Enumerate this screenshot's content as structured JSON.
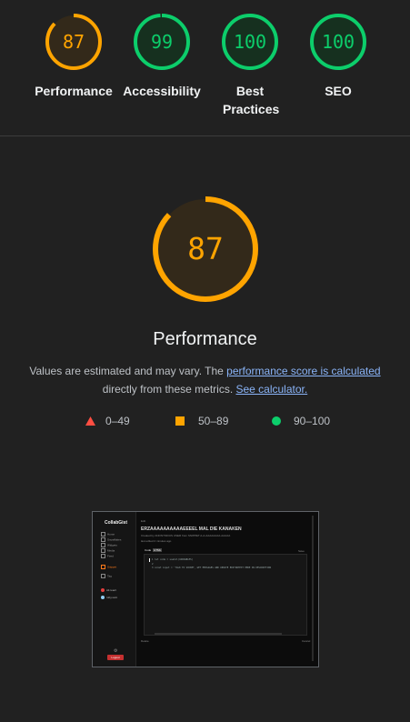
{
  "scores": [
    {
      "name": "Performance",
      "score": "87",
      "value": 87,
      "color": "#ffa400",
      "fill": "#33291a"
    },
    {
      "name": "Accessibility",
      "score": "99",
      "value": 99,
      "color": "#0cce6b",
      "fill": "#16301f"
    },
    {
      "name": "Best Practices",
      "score": "100",
      "value": 100,
      "color": "#0cce6b",
      "fill": "#16301f"
    },
    {
      "name": "SEO",
      "score": "100",
      "value": 100,
      "color": "#0cce6b",
      "fill": "#16301f"
    }
  ],
  "category": {
    "title": "Performance",
    "score": "87",
    "value": 87,
    "color": "#ffa400",
    "fill": "#33291a",
    "description_prefix": "Values are estimated and may vary. The ",
    "link_score": "performance score is calculated",
    "description_middle": " directly from these metrics. ",
    "link_calculator": "See calculator."
  },
  "legend": [
    {
      "range": "0–49",
      "shape": "triangle",
      "color": "#ff4e42"
    },
    {
      "range": "50–89",
      "shape": "square",
      "color": "#ffa400"
    },
    {
      "range": "90–100",
      "shape": "circle",
      "color": "#0cce6b"
    }
  ],
  "thumbnail": {
    "brand": "CollabGist",
    "nav": [
      "Home",
      "Snowflakes",
      "Widgets",
      "Media",
      "Feed"
    ],
    "nav_active": "Snippet",
    "nav_extra": "Tag",
    "users": [
      {
        "name": "Ali.react",
        "color": "#e53e3e"
      },
      {
        "name": "ruby.suni",
        "color": "#90cdf4"
      }
    ],
    "logout": "Logout",
    "crumb": "Edit",
    "title": "ERZAAAAAAAAAAEEEEL MAL DIE KANAKEN",
    "subtitle": "Created by ANONYMOUS USER from SNIPPET A-A-AAAAAAAA-AAAAA",
    "meta": "last edited 2 minutes ago",
    "tag_label": "Code",
    "tag_value": "HTML",
    "lines": [
      "1   let code = useCol(VARIABLES)",
      "2     ",
      "3   const input = 'TALK TO SOCKET, GET MESSAGES AND UPDATE EDITORTEXT HERE IN DESCRIPTION"
    ],
    "right_label": "Save",
    "footer_left": "Delete",
    "footer_right": "Cancel"
  }
}
